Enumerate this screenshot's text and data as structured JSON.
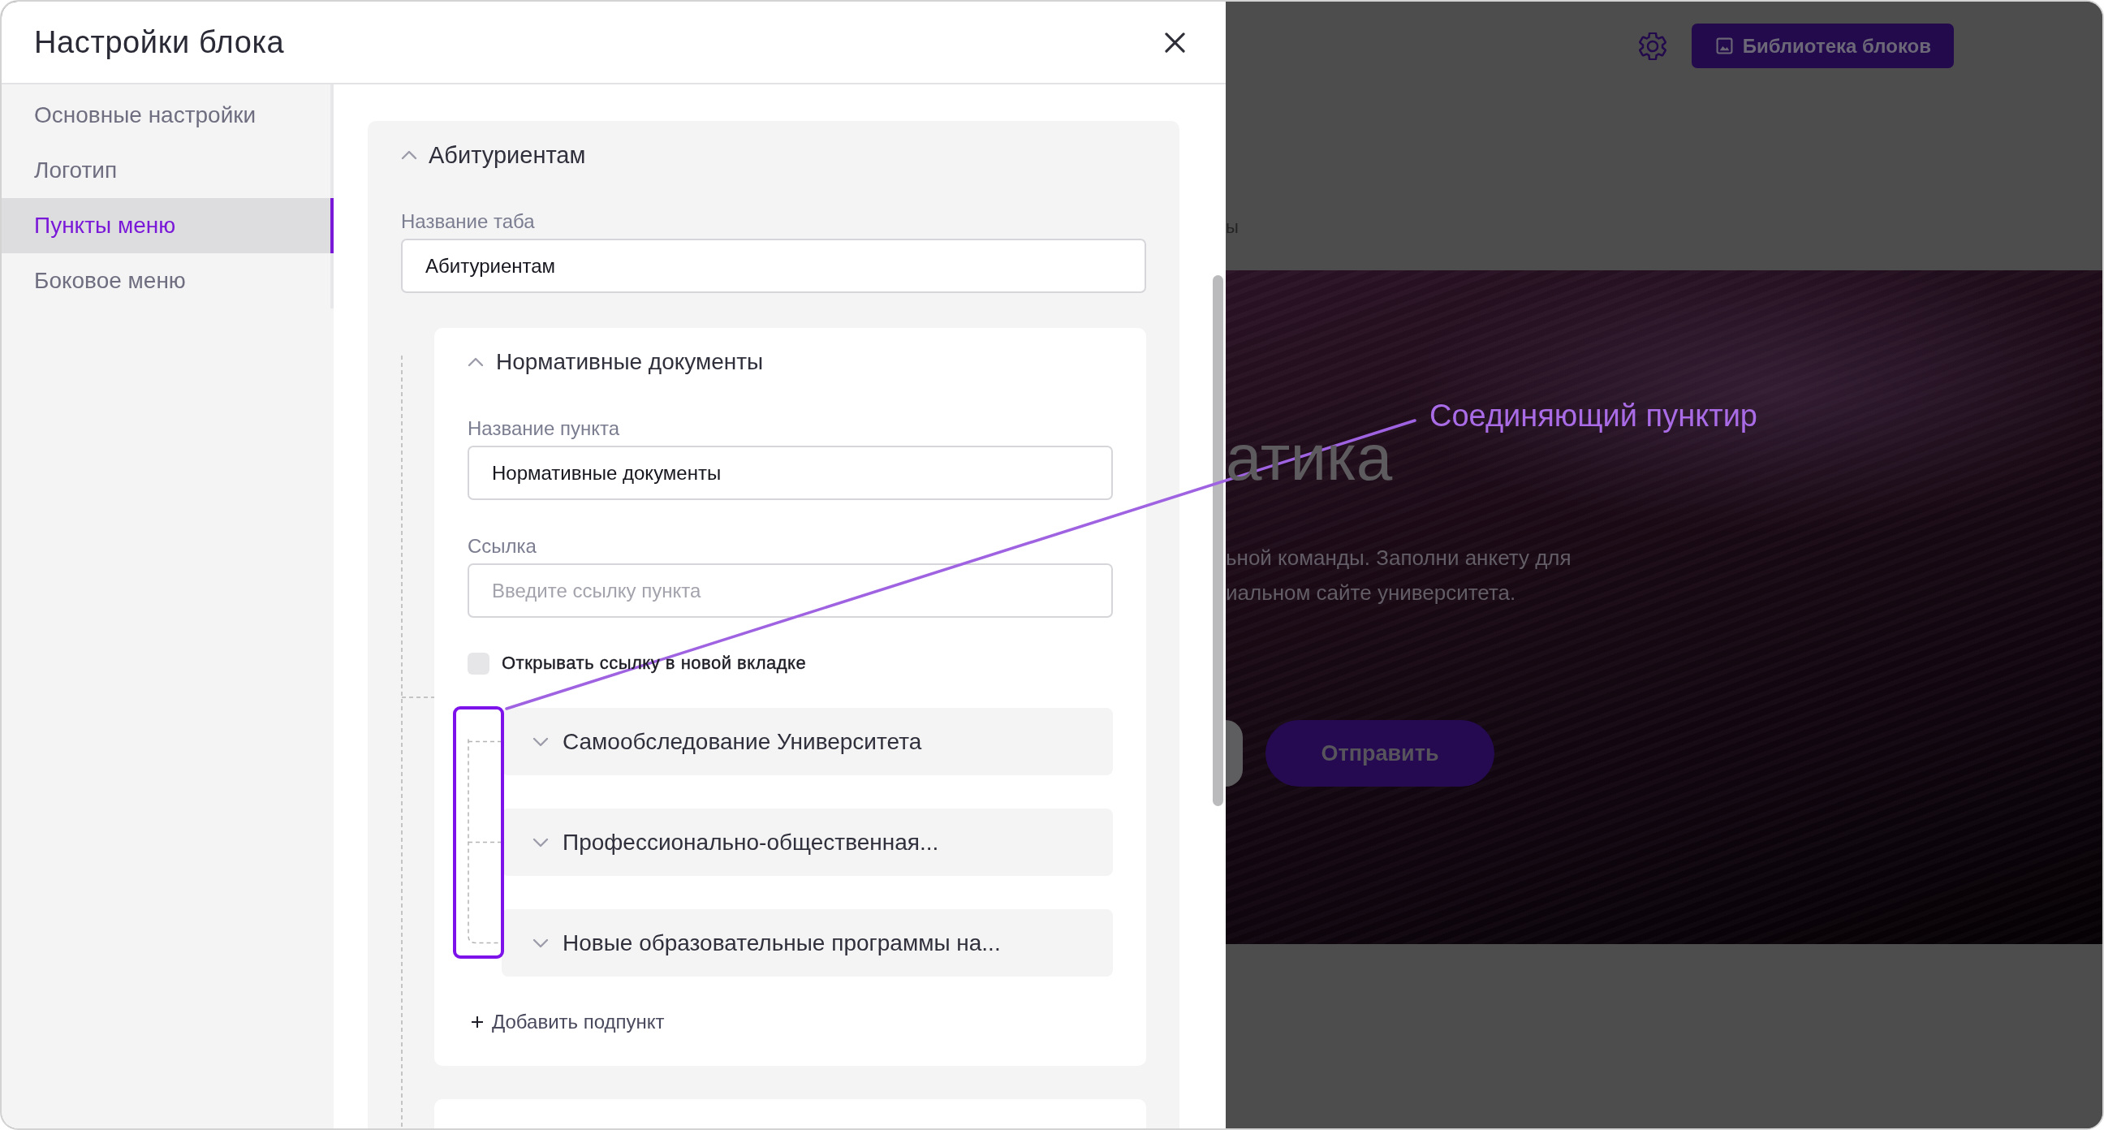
{
  "modal": {
    "title": "Настройки блока"
  },
  "sidebar": {
    "items": [
      {
        "label": "Основные настройки",
        "selected": false
      },
      {
        "label": "Логотип",
        "selected": false
      },
      {
        "label": "Пункты меню",
        "selected": true
      },
      {
        "label": "Боковое меню",
        "selected": false
      }
    ]
  },
  "section": {
    "title": "Абитуриентам",
    "expanded": true,
    "tab_name": {
      "label": "Название таба",
      "value": "Абитуриентам"
    },
    "menu_item": {
      "title": "Нормативные документы",
      "expanded": true,
      "name_field": {
        "label": "Название пункта",
        "value": "Нормативные документы"
      },
      "link_field": {
        "label": "Ссылка",
        "placeholder": "Введите ссылку пункта"
      },
      "new_tab": {
        "label": "Открывать ссылку в новой вкладке",
        "checked": false
      },
      "subitems": [
        {
          "title": "Самообследование Университета",
          "expanded": false
        },
        {
          "title": "Профессионально-общественная...",
          "expanded": false
        },
        {
          "title": "Новые образовательные программы на...",
          "expanded": false
        }
      ],
      "add_button": "Добавить подпункт"
    }
  },
  "background_page": {
    "library_button": "Библиотека блоков",
    "fragment": "ы",
    "hero": {
      "title": "атика",
      "text_lines": [
        "ьной команды. Заполни анкету для",
        "иальном сайте университета."
      ],
      "submit_button": "Отправить"
    }
  },
  "annotation": {
    "label": "Соединяющий пунктир"
  }
}
